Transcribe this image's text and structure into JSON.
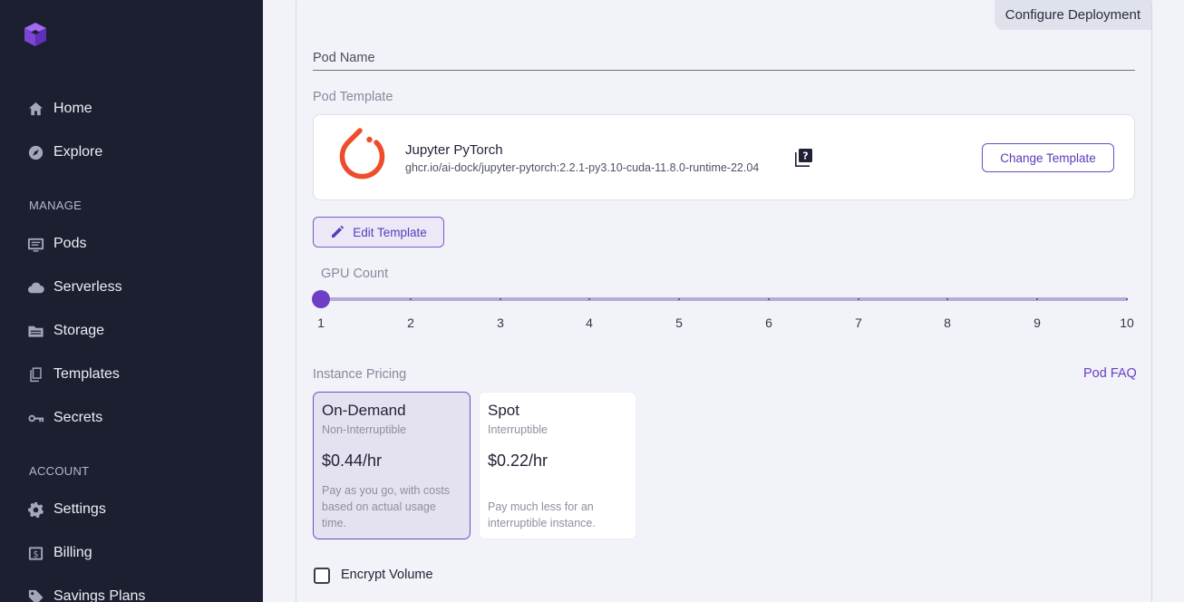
{
  "sidebar": {
    "items_top": [
      {
        "label": "Home",
        "icon": "home-icon"
      },
      {
        "label": "Explore",
        "icon": "compass-icon"
      }
    ],
    "manage_label": "MANAGE",
    "items_manage": [
      {
        "label": "Pods",
        "icon": "pods-icon"
      },
      {
        "label": "Serverless",
        "icon": "cloud-icon"
      },
      {
        "label": "Storage",
        "icon": "folder-icon"
      },
      {
        "label": "Templates",
        "icon": "templates-icon"
      },
      {
        "label": "Secrets",
        "icon": "key-icon"
      }
    ],
    "account_label": "ACCOUNT",
    "items_account": [
      {
        "label": "Settings",
        "icon": "gear-icon"
      },
      {
        "label": "Billing",
        "icon": "billing-icon"
      },
      {
        "label": "Savings Plans",
        "icon": "tag-icon"
      }
    ]
  },
  "main": {
    "card_tag": "Configure Deployment",
    "pod_name_label": "Pod Name",
    "pod_template_label": "Pod Template",
    "template": {
      "name": "Jupyter PyTorch",
      "image": "ghcr.io/ai-dock/jupyter-pytorch:2.2.1-py3.10-cuda-11.8.0-runtime-22.04",
      "change_label": "Change Template"
    },
    "edit_template_label": "Edit Template",
    "gpu_count_label": "GPU Count",
    "gpu_count_value": 1,
    "gpu_ticks": [
      "1",
      "2",
      "3",
      "4",
      "5",
      "6",
      "7",
      "8",
      "9",
      "10"
    ],
    "instance_pricing_label": "Instance Pricing",
    "pod_faq_label": "Pod FAQ",
    "pricing": [
      {
        "title": "On-Demand",
        "subtitle": "Non-Interruptible",
        "price": "$0.44/hr",
        "description": "Pay as you go, with costs based on actual usage time.",
        "selected": true
      },
      {
        "title": "Spot",
        "subtitle": "Interruptible",
        "price": "$0.22/hr",
        "description": "Pay much less for an interruptible instance.",
        "selected": false
      }
    ],
    "encrypt_volume_label": "Encrypt Volume",
    "encrypt_volume_checked": false
  },
  "colors": {
    "sidebar_bg": "#1c1f30",
    "accent": "#6d3fc7",
    "torch_orange": "#ee4c2c"
  }
}
